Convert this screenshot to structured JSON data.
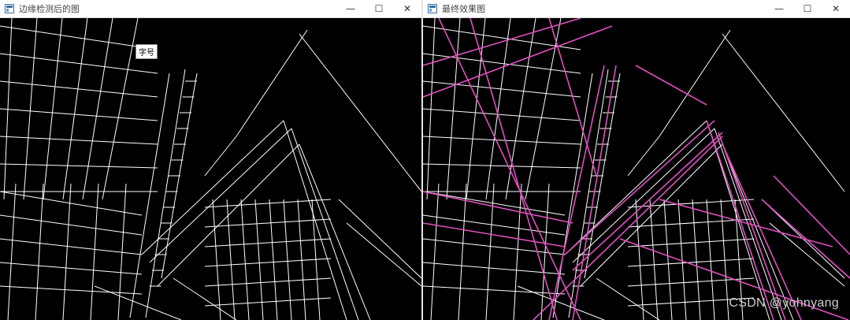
{
  "left_window": {
    "title": "边缘检测后的图",
    "tooltip": "字号",
    "controls": {
      "minimize": "—",
      "maximize": "☐",
      "close": "✕"
    }
  },
  "right_window": {
    "title": "最终效果图",
    "controls": {
      "minimize": "—",
      "maximize": "☐",
      "close": "✕"
    }
  },
  "watermark": "CSDN @yohnyang",
  "colors": {
    "edge": "#ffffff",
    "line": "#e14fc0",
    "background": "#000000"
  },
  "icons": {
    "app": "window-app-icon"
  }
}
